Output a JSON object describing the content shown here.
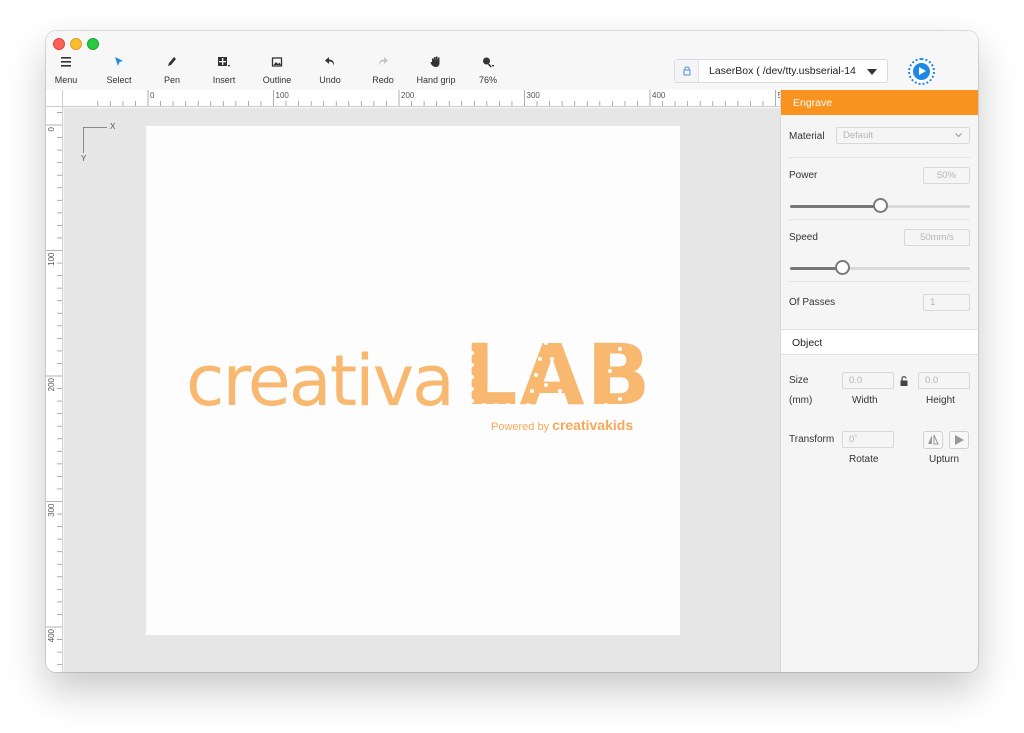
{
  "toolbar": {
    "menu": "Menu",
    "select": "Select",
    "pen": "Pen",
    "insert": "Insert",
    "outline": "Outline",
    "undo": "Undo",
    "redo": "Redo",
    "hand_grip": "Hand grip",
    "zoom": "76%"
  },
  "device": {
    "name": "LaserBox ( /dev/tty.usbserial-14"
  },
  "ruler": {
    "top_ticks": [
      "0",
      "100",
      "200",
      "300",
      "400",
      "5"
    ],
    "left_ticks": [
      "0",
      "100",
      "200",
      "300",
      "400"
    ]
  },
  "canvas": {
    "axis_x": "X",
    "axis_y": "Y",
    "logo_word": "creativa",
    "logo_lab": "LAB",
    "logo_powered": "Powered by",
    "logo_kids_brand": "creativakids"
  },
  "panel": {
    "header": "Engrave",
    "material_label": "Material",
    "material_value": "Default",
    "power_label": "Power",
    "power_value": "50%",
    "power_level": 0.5,
    "speed_label": "Speed",
    "speed_value": "50mm/s",
    "speed_level": 0.29,
    "passes_label": "Of Passes",
    "passes_value": "1",
    "object_header": "Object",
    "size_label": "Size",
    "size_unit": "(mm)",
    "width_value": "0.0",
    "width_label": "Width",
    "height_value": "0.0",
    "height_label": "Height",
    "transform_label": "Transform",
    "rotate_value": "0˚",
    "rotate_label": "Rotate",
    "upturn_label": "Upturn"
  },
  "colors": {
    "accent": "#f7931e",
    "run": "#1e88e5",
    "logo": "#f8b870"
  }
}
